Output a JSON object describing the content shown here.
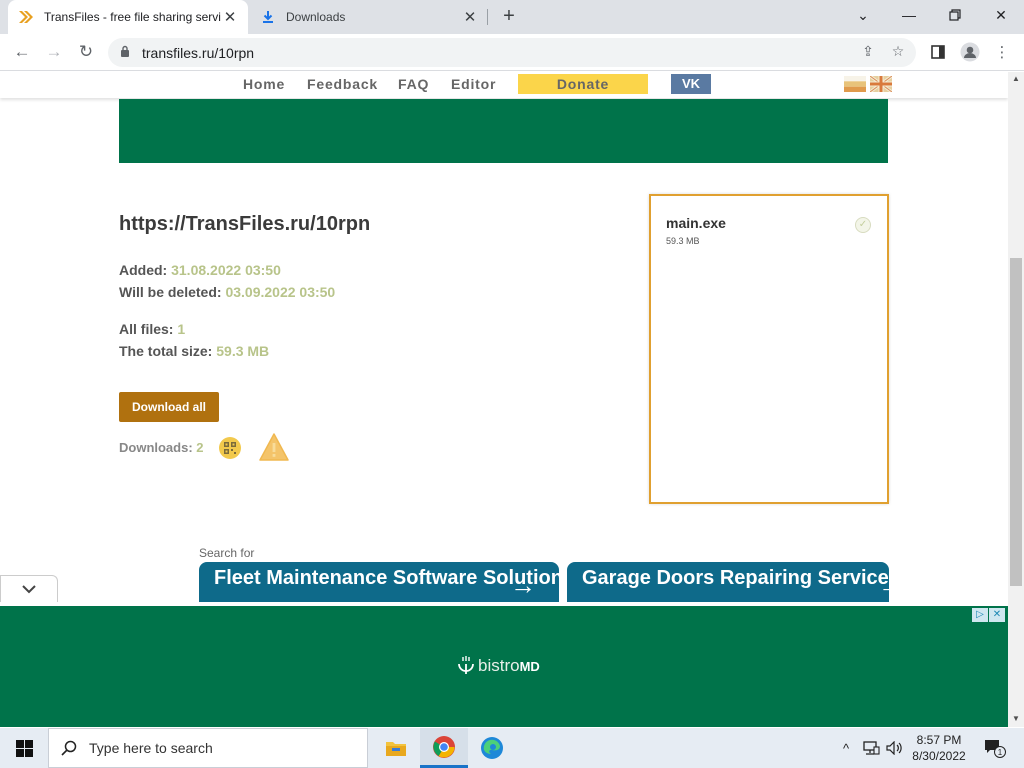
{
  "browser": {
    "tabs": [
      {
        "title": "TransFiles - free file sharing servi",
        "active": true
      },
      {
        "title": "Downloads",
        "active": false
      }
    ],
    "new_tab": "+",
    "url": "transfiles.ru/10rpn"
  },
  "site": {
    "nav": {
      "home": "Home",
      "feedback": "Feedback",
      "faq": "FAQ",
      "editor": "Editor",
      "donate": "Donate",
      "vk": "VK"
    },
    "page_url": "https://TransFiles.ru/10rpn",
    "added_label": "Added:",
    "added_value": "31.08.2022 03:50",
    "deleted_label": "Will be deleted:",
    "deleted_value": "03.09.2022 03:50",
    "all_files_label": "All files:",
    "all_files_value": "1",
    "total_size_label": "The total size:",
    "total_size_value": "59.3 MB",
    "download_all": "Download all",
    "downloads_label": "Downloads:",
    "downloads_value": "2",
    "file": {
      "name": "main.exe",
      "size": "59.3 MB"
    },
    "search_for": "Search for",
    "ads": [
      {
        "text": "Fleet Maintenance Software Solution"
      },
      {
        "text": "Garage Doors Repairing Services Prices"
      }
    ],
    "bottom_ad": {
      "brand_light": "bistro",
      "brand_bold": "MD"
    }
  },
  "taskbar": {
    "search_placeholder": "Type here to search",
    "time": "8:57 PM",
    "date": "8/30/2022",
    "notification_count": "1"
  },
  "colors": {
    "accent_green": "#00734a",
    "download_button": "#b0710f",
    "donate_yellow": "#fbd54a",
    "vk_blue": "#5a7aa2",
    "file_border": "#e0a030",
    "value_text": "#b8c48a"
  }
}
